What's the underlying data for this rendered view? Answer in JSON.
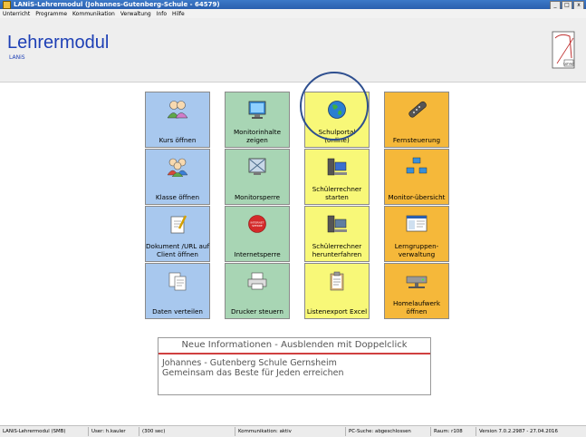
{
  "window": {
    "title": "LANiS-Lehrermodul  (Johannes-Gutenberg-Schule - 64579)",
    "controls": [
      "_",
      "□",
      "x"
    ]
  },
  "menu": [
    "Unterricht",
    "Programme",
    "Kommunikation",
    "Verwaltung",
    "Info",
    "Hilfe"
  ],
  "header": {
    "title": "Lehrermodul",
    "subtitle": "LANiS",
    "logo_text": "Lehrer"
  },
  "tiles": [
    {
      "id": "kurs-oeffnen",
      "label": "Kurs öffnen",
      "color": "blue",
      "icon": "users-icon"
    },
    {
      "id": "monitorinhalte",
      "label": "Monitorinhalte zeigen",
      "color": "green",
      "icon": "monitor-icon"
    },
    {
      "id": "schulportal",
      "label": "Schulportal (online)",
      "color": "yellow",
      "icon": "globe-icon"
    },
    {
      "id": "fernsteuerung",
      "label": "Fernsteuerung",
      "color": "orange",
      "icon": "remote-icon"
    },
    {
      "id": "klasse-oeffnen",
      "label": "Klasse öffnen",
      "color": "blue",
      "icon": "group-icon"
    },
    {
      "id": "monitorsperre",
      "label": "Monitorsperre",
      "color": "green",
      "icon": "screen-lock-icon"
    },
    {
      "id": "schuelerrechner-starten",
      "label": "Schülerrechner starten",
      "color": "yellow",
      "icon": "computer-icon"
    },
    {
      "id": "monitoruebersicht",
      "label": "Monitor-übersicht",
      "color": "orange",
      "icon": "monitors-grid-icon"
    },
    {
      "id": "dokument-url",
      "label": "Dokument /URL auf Client öffnen",
      "color": "blue",
      "icon": "document-edit-icon"
    },
    {
      "id": "internetsperre",
      "label": "Internetsperre",
      "color": "green",
      "icon": "internet-block-icon"
    },
    {
      "id": "schuelerrechner-herunterfahren",
      "label": "Schülerrechner herunterfahren",
      "color": "yellow",
      "icon": "computer-icon"
    },
    {
      "id": "lerngruppenverwaltung",
      "label": "Lerngruppen-verwaltung",
      "color": "orange",
      "icon": "window-icon"
    },
    {
      "id": "daten-verteilen",
      "label": "Daten verteilen",
      "color": "blue",
      "icon": "documents-icon"
    },
    {
      "id": "drucker-steuern",
      "label": "Drucker steuern",
      "color": "green",
      "icon": "printer-icon"
    },
    {
      "id": "listenexport",
      "label": "Listenexport Excel",
      "color": "yellow",
      "icon": "clipboard-icon"
    },
    {
      "id": "homelaufwerk",
      "label": "Homelaufwerk öffnen",
      "color": "orange",
      "icon": "drive-icon"
    }
  ],
  "internet_stop_text": "INTERNET SPERRE",
  "info": {
    "heading": "Neue Informationen - Ausblenden mit Doppelclick",
    "line1": "Johannes - Gutenberg Schule Gernsheim",
    "line2": "Gemeinsam das Beste für Jeden erreichen"
  },
  "status": [
    "LANiS-Lehrermodul (SMB)",
    "User: h.kauler",
    "(300 sec)",
    "Kommunikation: aktiv",
    "PC-Suche: abgeschlossen",
    "Raum: r108",
    "Version 7.0.2.2987 - 27.04.2016"
  ],
  "colors": {
    "blue": "#a8c8ee",
    "green": "#a8d5b4",
    "yellow": "#f8f878",
    "orange": "#f5b83a",
    "title": "#1d3fb5"
  }
}
